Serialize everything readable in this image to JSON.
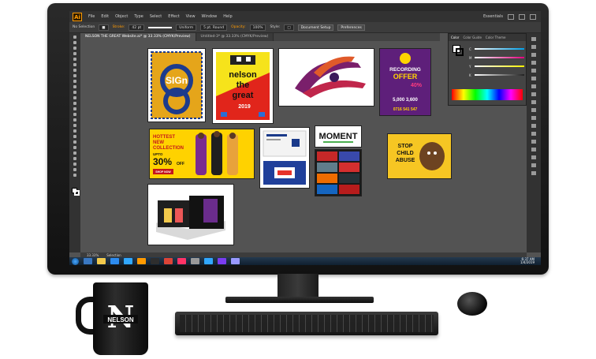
{
  "menu": {
    "logo": "Ai",
    "items": [
      "File",
      "Edit",
      "Object",
      "Type",
      "Select",
      "Effect",
      "View",
      "Window",
      "Help"
    ],
    "workspace": "Essentials"
  },
  "control_bar": {
    "selection": "No Selection",
    "stroke_label": "Stroke:",
    "stroke_value": "42 pt",
    "profile": "Uniform",
    "brush": "5 pt. Round",
    "opacity_label": "Opacity:",
    "opacity_value": "100%",
    "style_label": "Style:",
    "document_setup": "Document Setup",
    "preferences": "Preferences"
  },
  "tabs": [
    {
      "label": "NELSON THE GREAT Website.ai* @ 33.33% (CMYK/Preview)",
      "active": true
    },
    {
      "label": "Untitled-3* @ 33.33% (CMYK/Preview)",
      "active": false
    }
  ],
  "color_panel": {
    "tabs": [
      "Color",
      "Color Guide",
      "Color Theme"
    ],
    "sliders": [
      {
        "letter": "C",
        "color": "#00a0e9"
      },
      {
        "letter": "M",
        "color": "#e4007f"
      },
      {
        "letter": "Y",
        "color": "#fff100"
      },
      {
        "letter": "K",
        "color": "#222222"
      }
    ]
  },
  "artboards": {
    "sign_text": "SIGn",
    "nelson_poster": {
      "line1": "nelson",
      "line2": "the",
      "line3": "great",
      "year": "2019"
    },
    "recording": {
      "title": "RECORDING",
      "offer": "OFFER",
      "percent": "40%",
      "prices": "5,000  3,600",
      "phone": "0716 541 547"
    },
    "hottest": {
      "line1": "HOTTEST",
      "line2": "NEW",
      "line3": "COLLECTION",
      "upto": "UPTO",
      "percent": "30%",
      "off": "OFF",
      "cta": "SHOP NOW"
    },
    "moment": {
      "text": "MOMENT"
    },
    "stop_abuse": {
      "line1": "STOP",
      "line2": "CHILD",
      "line3": "ABUSE"
    }
  },
  "status": {
    "zoom": "33.33%",
    "tool": "Selection"
  },
  "taskbar": {
    "time": "6:37 AM",
    "date": "1/4/2019"
  },
  "mug": {
    "letter": "N",
    "text": "NELSON"
  }
}
